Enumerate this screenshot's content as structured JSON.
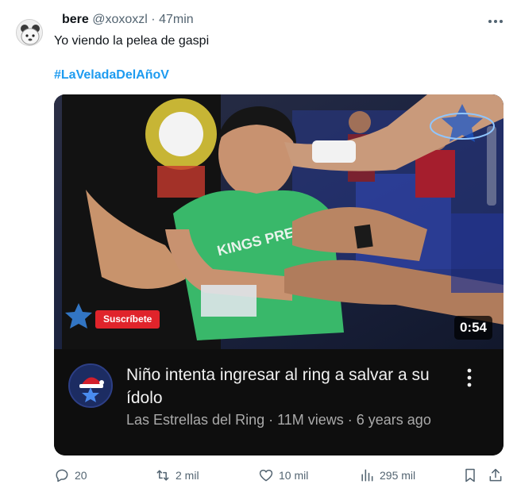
{
  "tweet": {
    "display_name": "bere",
    "handle": "@xoxoxzl",
    "separator": "·",
    "time": "47min",
    "text": "Yo viendo la pelea de gaspi",
    "hashtag": "#LaVeladaDelAñoV"
  },
  "video": {
    "title": "Niño intenta ingresar al ring a salvar a su ídolo",
    "meta": "Las Estrellas del Ring · 11M views · 6 years ago",
    "duration": "0:54",
    "subscribe_label": "Suscríbete"
  },
  "actions": {
    "replies": "20",
    "reposts": "2 mil",
    "likes": "10 mil",
    "views": "295 mil"
  },
  "icons": {
    "more": "more-icon",
    "reply": "reply-icon",
    "repost": "repost-icon",
    "like": "heart-icon",
    "views": "views-icon",
    "bookmark": "bookmark-icon",
    "share": "share-icon"
  },
  "colors": {
    "hashtag": "#1d9bf0",
    "secondary_text": "#536471",
    "card_bg": "#0e0e0e",
    "subscribe_red": "#e0242b"
  }
}
